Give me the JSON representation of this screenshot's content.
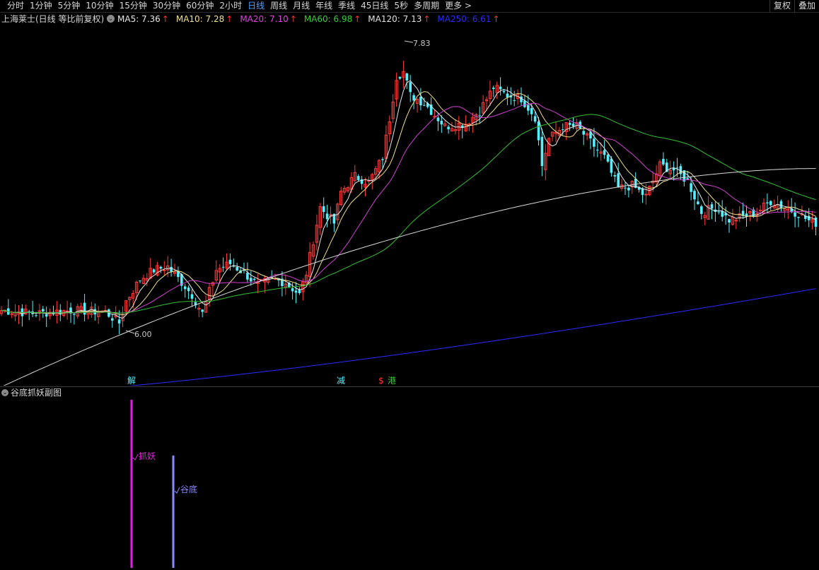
{
  "toolbar": {
    "tabs": [
      "分时",
      "1分钟",
      "5分钟",
      "10分钟",
      "15分钟",
      "30分钟",
      "60分钟",
      "2小时",
      "日线",
      "周线",
      "月线",
      "年线",
      "季线",
      "45日线",
      "5秒",
      "多周期",
      "更多 >"
    ],
    "active_tab": "日线",
    "right_buttons": [
      "复权",
      "叠加"
    ]
  },
  "infobar": {
    "stock_label": "上海莱士(日线 等比前复权)",
    "collapse_glyph": "⌄",
    "ma": [
      {
        "label": "MA5:",
        "value": "7.36",
        "color": "#e8e8e8"
      },
      {
        "label": "MA10:",
        "value": "7.28",
        "color": "#f0e08a"
      },
      {
        "label": "MA20:",
        "value": "7.10",
        "color": "#e040e0"
      },
      {
        "label": "MA60:",
        "value": "6.98",
        "color": "#30d030"
      },
      {
        "label": "MA120:",
        "value": "7.13",
        "color": "#e0e0e0"
      },
      {
        "label": "MA250:",
        "value": "6.61",
        "color": "#2a2aff"
      }
    ],
    "arrow_glyph": "↑"
  },
  "colors": {
    "up": "#ff3a3a",
    "down": "#54f0ff",
    "ma5": "#e8e8e8",
    "ma10": "#f0e08a",
    "ma20": "#d040d0",
    "ma60": "#30c030",
    "ma120": "#d8d8d8",
    "ma250": "#2a2aff"
  },
  "chart_data": {
    "type": "candlestick",
    "annotations": {
      "high": {
        "value": "7.83"
      },
      "low": {
        "value": "6.00"
      }
    },
    "event_markers": [
      {
        "text": "解",
        "color": "#54f0ff"
      },
      {
        "text": "减",
        "color": "#54f0ff"
      },
      {
        "text": "$",
        "color": "#ff3a3a"
      },
      {
        "text": "港",
        "color": "#30d030"
      }
    ],
    "ma_series_note_values": {
      "MA5": 7.36,
      "MA10": 7.28,
      "MA20": 7.1,
      "MA60": 6.98,
      "MA120": 7.13,
      "MA250": 6.61
    }
  },
  "sub_chart": {
    "title": "谷底抓妖副图",
    "collapse_glyph": "⌄",
    "signals": [
      {
        "label": "抓妖",
        "color": "#e020e0"
      },
      {
        "label": "谷底",
        "color": "#8a8aff"
      }
    ]
  }
}
